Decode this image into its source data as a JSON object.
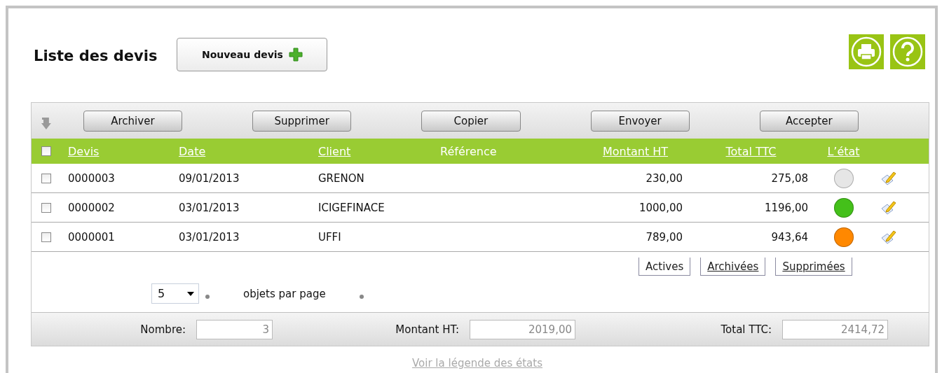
{
  "header": {
    "title": "Liste des devis",
    "new_button": "Nouveau devis"
  },
  "toolbar": {
    "buttons": [
      "Archiver",
      "Supprimer",
      "Copier",
      "Envoyer",
      "Accepter"
    ]
  },
  "table": {
    "select_all_checked": false,
    "columns": [
      {
        "label": "Devis",
        "sortable": true
      },
      {
        "label": "Date",
        "sortable": true
      },
      {
        "label": "Client",
        "sortable": true
      },
      {
        "label": "Référence",
        "sortable": false
      },
      {
        "label": "Montant HT",
        "sortable": true
      },
      {
        "label": "Total TTC",
        "sortable": true
      },
      {
        "label": "L’état",
        "sortable": true
      }
    ],
    "rows": [
      {
        "checked": false,
        "devis": "0000003",
        "date": "09/01/2013",
        "client": "GRENON",
        "montant_ht": "230,00",
        "total_ttc": "275,08",
        "color": "#e6e6e6"
      },
      {
        "checked": false,
        "devis": "0000002",
        "date": "03/01/2013",
        "client": "ICIGEFINACE",
        "montant_ht": "1000,00",
        "total_ttc": "1196,00",
        "color": "#44c01a"
      },
      {
        "checked": false,
        "devis": "0000001",
        "date": "03/01/2013",
        "client": "UFFI",
        "montant_ht": "789,00",
        "total_ttc": "943,64",
        "color": "#ff8800"
      }
    ]
  },
  "filter_tabs": [
    {
      "label": "Actives",
      "selected": true
    },
    {
      "label": "Archivées",
      "selected": false
    },
    {
      "label": "Supprimées",
      "selected": false
    }
  ],
  "pagination": {
    "per_page": "5",
    "label": "objets par page"
  },
  "totals": [
    {
      "label": "Nombre:",
      "value": "3"
    },
    {
      "label": "Montant HT:",
      "value": "2019,00"
    },
    {
      "label": "Total TTC:",
      "value": "2414,72"
    }
  ],
  "legend_link": "Voir la légende des états"
}
